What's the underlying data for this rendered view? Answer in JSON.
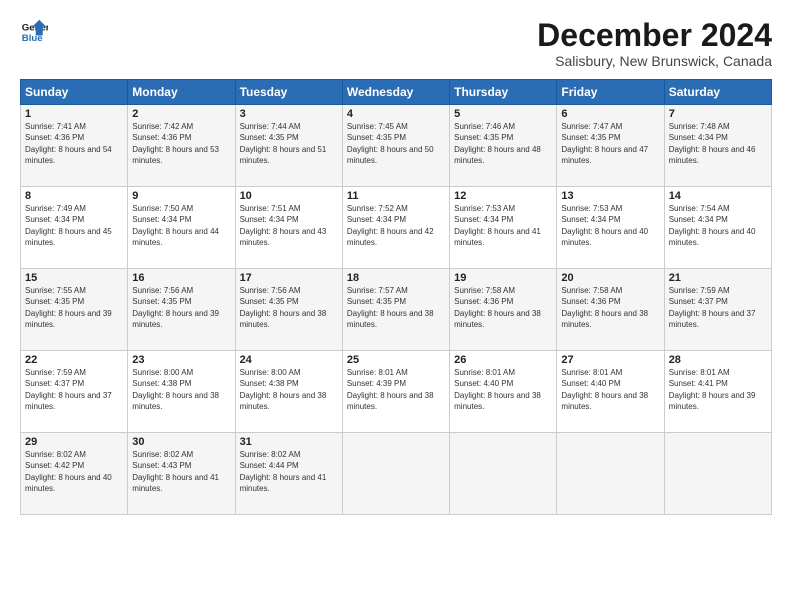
{
  "logo": {
    "line1": "General",
    "line2": "Blue"
  },
  "title": "December 2024",
  "subtitle": "Salisbury, New Brunswick, Canada",
  "days_of_week": [
    "Sunday",
    "Monday",
    "Tuesday",
    "Wednesday",
    "Thursday",
    "Friday",
    "Saturday"
  ],
  "weeks": [
    [
      {
        "day": "1",
        "sunrise": "Sunrise: 7:41 AM",
        "sunset": "Sunset: 4:36 PM",
        "daylight": "Daylight: 8 hours and 54 minutes."
      },
      {
        "day": "2",
        "sunrise": "Sunrise: 7:42 AM",
        "sunset": "Sunset: 4:36 PM",
        "daylight": "Daylight: 8 hours and 53 minutes."
      },
      {
        "day": "3",
        "sunrise": "Sunrise: 7:44 AM",
        "sunset": "Sunset: 4:35 PM",
        "daylight": "Daylight: 8 hours and 51 minutes."
      },
      {
        "day": "4",
        "sunrise": "Sunrise: 7:45 AM",
        "sunset": "Sunset: 4:35 PM",
        "daylight": "Daylight: 8 hours and 50 minutes."
      },
      {
        "day": "5",
        "sunrise": "Sunrise: 7:46 AM",
        "sunset": "Sunset: 4:35 PM",
        "daylight": "Daylight: 8 hours and 48 minutes."
      },
      {
        "day": "6",
        "sunrise": "Sunrise: 7:47 AM",
        "sunset": "Sunset: 4:35 PM",
        "daylight": "Daylight: 8 hours and 47 minutes."
      },
      {
        "day": "7",
        "sunrise": "Sunrise: 7:48 AM",
        "sunset": "Sunset: 4:34 PM",
        "daylight": "Daylight: 8 hours and 46 minutes."
      }
    ],
    [
      {
        "day": "8",
        "sunrise": "Sunrise: 7:49 AM",
        "sunset": "Sunset: 4:34 PM",
        "daylight": "Daylight: 8 hours and 45 minutes."
      },
      {
        "day": "9",
        "sunrise": "Sunrise: 7:50 AM",
        "sunset": "Sunset: 4:34 PM",
        "daylight": "Daylight: 8 hours and 44 minutes."
      },
      {
        "day": "10",
        "sunrise": "Sunrise: 7:51 AM",
        "sunset": "Sunset: 4:34 PM",
        "daylight": "Daylight: 8 hours and 43 minutes."
      },
      {
        "day": "11",
        "sunrise": "Sunrise: 7:52 AM",
        "sunset": "Sunset: 4:34 PM",
        "daylight": "Daylight: 8 hours and 42 minutes."
      },
      {
        "day": "12",
        "sunrise": "Sunrise: 7:53 AM",
        "sunset": "Sunset: 4:34 PM",
        "daylight": "Daylight: 8 hours and 41 minutes."
      },
      {
        "day": "13",
        "sunrise": "Sunrise: 7:53 AM",
        "sunset": "Sunset: 4:34 PM",
        "daylight": "Daylight: 8 hours and 40 minutes."
      },
      {
        "day": "14",
        "sunrise": "Sunrise: 7:54 AM",
        "sunset": "Sunset: 4:34 PM",
        "daylight": "Daylight: 8 hours and 40 minutes."
      }
    ],
    [
      {
        "day": "15",
        "sunrise": "Sunrise: 7:55 AM",
        "sunset": "Sunset: 4:35 PM",
        "daylight": "Daylight: 8 hours and 39 minutes."
      },
      {
        "day": "16",
        "sunrise": "Sunrise: 7:56 AM",
        "sunset": "Sunset: 4:35 PM",
        "daylight": "Daylight: 8 hours and 39 minutes."
      },
      {
        "day": "17",
        "sunrise": "Sunrise: 7:56 AM",
        "sunset": "Sunset: 4:35 PM",
        "daylight": "Daylight: 8 hours and 38 minutes."
      },
      {
        "day": "18",
        "sunrise": "Sunrise: 7:57 AM",
        "sunset": "Sunset: 4:35 PM",
        "daylight": "Daylight: 8 hours and 38 minutes."
      },
      {
        "day": "19",
        "sunrise": "Sunrise: 7:58 AM",
        "sunset": "Sunset: 4:36 PM",
        "daylight": "Daylight: 8 hours and 38 minutes."
      },
      {
        "day": "20",
        "sunrise": "Sunrise: 7:58 AM",
        "sunset": "Sunset: 4:36 PM",
        "daylight": "Daylight: 8 hours and 38 minutes."
      },
      {
        "day": "21",
        "sunrise": "Sunrise: 7:59 AM",
        "sunset": "Sunset: 4:37 PM",
        "daylight": "Daylight: 8 hours and 37 minutes."
      }
    ],
    [
      {
        "day": "22",
        "sunrise": "Sunrise: 7:59 AM",
        "sunset": "Sunset: 4:37 PM",
        "daylight": "Daylight: 8 hours and 37 minutes."
      },
      {
        "day": "23",
        "sunrise": "Sunrise: 8:00 AM",
        "sunset": "Sunset: 4:38 PM",
        "daylight": "Daylight: 8 hours and 38 minutes."
      },
      {
        "day": "24",
        "sunrise": "Sunrise: 8:00 AM",
        "sunset": "Sunset: 4:38 PM",
        "daylight": "Daylight: 8 hours and 38 minutes."
      },
      {
        "day": "25",
        "sunrise": "Sunrise: 8:01 AM",
        "sunset": "Sunset: 4:39 PM",
        "daylight": "Daylight: 8 hours and 38 minutes."
      },
      {
        "day": "26",
        "sunrise": "Sunrise: 8:01 AM",
        "sunset": "Sunset: 4:40 PM",
        "daylight": "Daylight: 8 hours and 38 minutes."
      },
      {
        "day": "27",
        "sunrise": "Sunrise: 8:01 AM",
        "sunset": "Sunset: 4:40 PM",
        "daylight": "Daylight: 8 hours and 38 minutes."
      },
      {
        "day": "28",
        "sunrise": "Sunrise: 8:01 AM",
        "sunset": "Sunset: 4:41 PM",
        "daylight": "Daylight: 8 hours and 39 minutes."
      }
    ],
    [
      {
        "day": "29",
        "sunrise": "Sunrise: 8:02 AM",
        "sunset": "Sunset: 4:42 PM",
        "daylight": "Daylight: 8 hours and 40 minutes."
      },
      {
        "day": "30",
        "sunrise": "Sunrise: 8:02 AM",
        "sunset": "Sunset: 4:43 PM",
        "daylight": "Daylight: 8 hours and 41 minutes."
      },
      {
        "day": "31",
        "sunrise": "Sunrise: 8:02 AM",
        "sunset": "Sunset: 4:44 PM",
        "daylight": "Daylight: 8 hours and 41 minutes."
      },
      null,
      null,
      null,
      null
    ]
  ]
}
